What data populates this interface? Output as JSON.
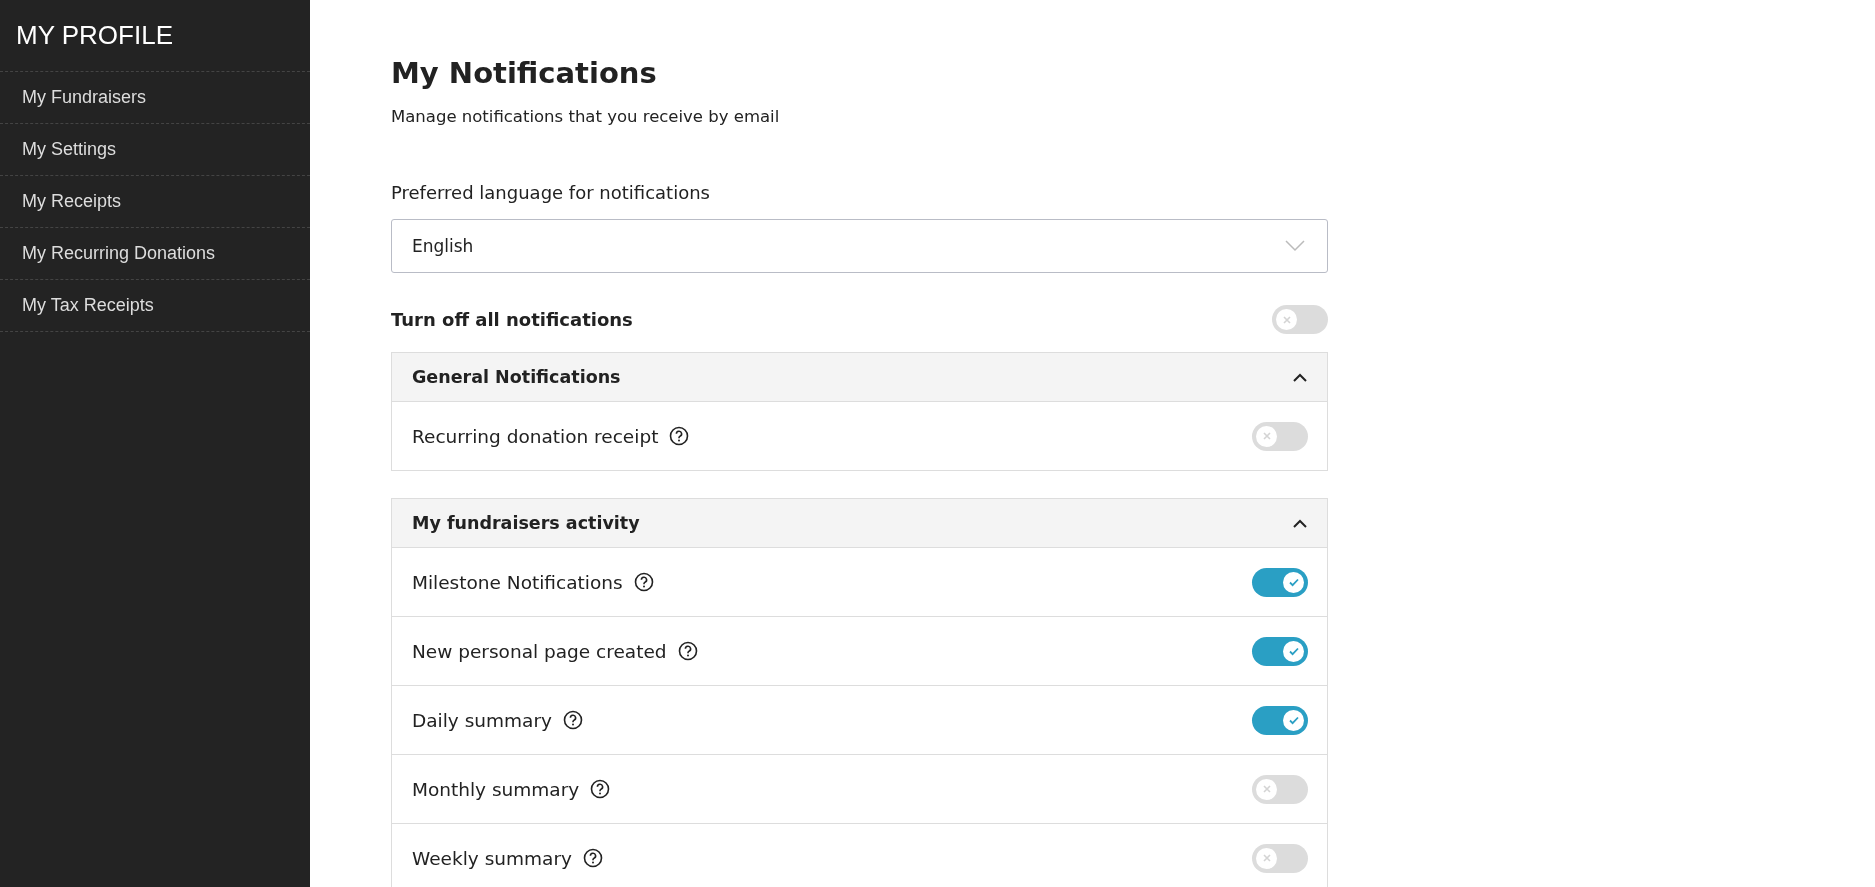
{
  "sidebar": {
    "title": "MY PROFILE",
    "items": [
      {
        "label": "My Fundraisers"
      },
      {
        "label": "My Settings"
      },
      {
        "label": "My Receipts"
      },
      {
        "label": "My Recurring Donations"
      },
      {
        "label": "My Tax Receipts"
      }
    ]
  },
  "page": {
    "title": "My Notifications",
    "subtitle": "Manage notifications that you receive by email"
  },
  "language": {
    "label": "Preferred language for notifications",
    "value": "English"
  },
  "turn_off_all": {
    "label": "Turn off all notifications",
    "on": false
  },
  "sections": [
    {
      "title": "General Notifications",
      "expanded": true,
      "items": [
        {
          "label": "Recurring donation receipt",
          "on": false
        }
      ]
    },
    {
      "title": "My fundraisers activity",
      "expanded": true,
      "items": [
        {
          "label": "Milestone Notifications",
          "on": true
        },
        {
          "label": "New personal page created",
          "on": true
        },
        {
          "label": "Daily summary",
          "on": true
        },
        {
          "label": "Monthly summary",
          "on": false
        },
        {
          "label": "Weekly summary",
          "on": false
        }
      ]
    }
  ]
}
